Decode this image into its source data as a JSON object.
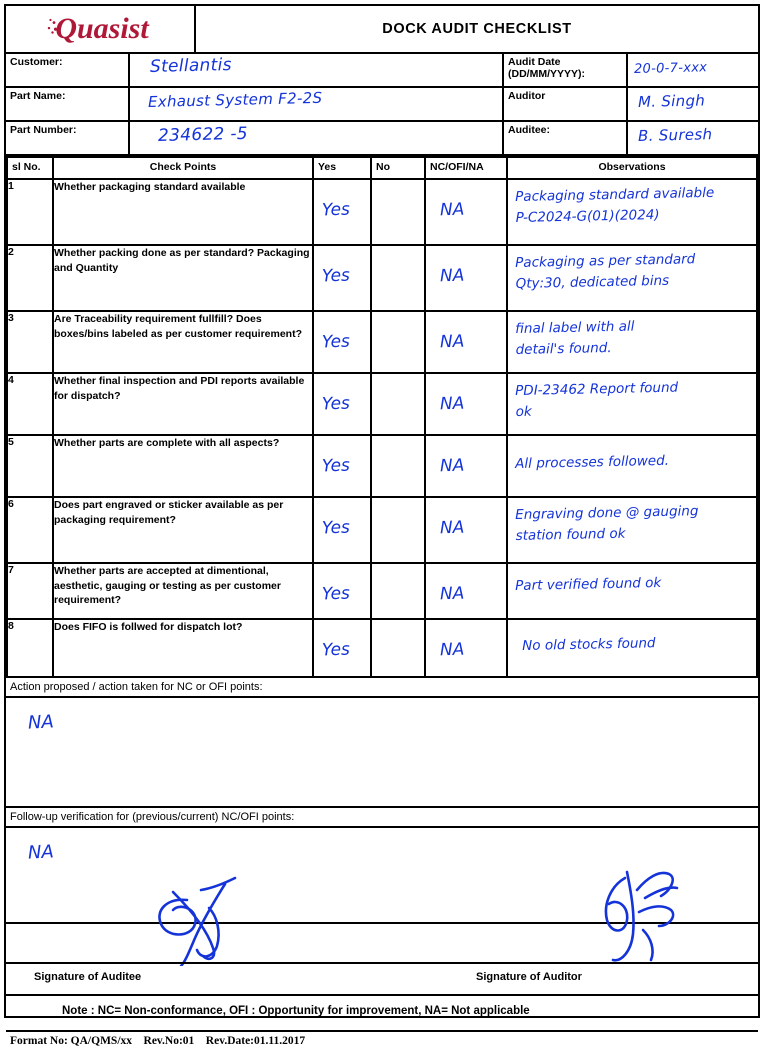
{
  "header": {
    "logo_text": "Quasist",
    "document_title": "DOCK AUDIT CHECKLIST"
  },
  "meta": {
    "customer_label": "Customer:",
    "customer_value": "Stellantis",
    "part_name_label": "Part Name:",
    "part_name_value": "Exhaust System F2-2S",
    "part_number_label": "Part Number:",
    "part_number_value": "234622 -5",
    "audit_date_label": "Audit Date (DD/MM/YYYY):",
    "audit_date_label_line1": "Audit Date",
    "audit_date_label_line2": "(DD/MM/YYYY):",
    "audit_date_value": "20-0-7-xxx",
    "auditor_label": "Auditor",
    "auditor_value": "M. Singh",
    "auditee_label": "Auditee:",
    "auditee_value": "B. Suresh"
  },
  "table": {
    "columns": [
      "sl No.",
      "Check Points",
      "Yes",
      "No",
      "NC/OFI/NA",
      "Observations"
    ],
    "rows": [
      {
        "sl": "1",
        "checkpoint": "Whether packaging standard available",
        "yes": "Yes",
        "no": "",
        "nc": "NA",
        "observation_line1": "Packaging standard available",
        "observation_line2": "P-C2024-G(01)(2024)"
      },
      {
        "sl": "2",
        "checkpoint": "Whether packing done as per standard? Packaging and Quantity",
        "yes": "Yes",
        "no": "",
        "nc": "NA",
        "observation_line1": "Packaging as per standard",
        "observation_line2": "Qty:30, dedicated bins"
      },
      {
        "sl": "3",
        "checkpoint": "Are Traceability requirement fullfill? Does boxes/bins labeled as per customer requirement?",
        "yes": "Yes",
        "no": "",
        "nc": "NA",
        "observation_line1": "final label with all",
        "observation_line2": "detail's found."
      },
      {
        "sl": "4",
        "checkpoint": "Whether final inspection and PDI reports available for dispatch?",
        "yes": "Yes",
        "no": "",
        "nc": "NA",
        "observation_line1": "PDI-23462 Report found",
        "observation_line2": "ok"
      },
      {
        "sl": "5",
        "checkpoint": "Whether parts are complete with all aspects?",
        "yes": "Yes",
        "no": "",
        "nc": "NA",
        "observation_line1": "All processes followed.",
        "observation_line2": ""
      },
      {
        "sl": "6",
        "checkpoint": "Does part engraved or sticker available as per packaging requirement?",
        "yes": "Yes",
        "no": "",
        "nc": "NA",
        "observation_line1": "Engraving done @ gauging",
        "observation_line2": "station found ok"
      },
      {
        "sl": "7",
        "checkpoint": "Whether parts are accepted at dimentional, aesthetic, gauging or testing as per customer requirement?",
        "yes": "Yes",
        "no": "",
        "nc": "NA",
        "observation_line1": "Part verified found ok",
        "observation_line2": ""
      },
      {
        "sl": "8",
        "checkpoint": "Does FIFO is follwed for dispatch lot?",
        "yes": "Yes",
        "no": "",
        "nc": "NA",
        "observation_line1": "No old stocks found",
        "observation_line2": ""
      }
    ]
  },
  "action_section": {
    "label": "Action proposed / action taken for NC or OFI points:",
    "value": "NA"
  },
  "followup_section": {
    "label": "Follow-up verification for (previous/current) NC/OFI points:",
    "value": "NA"
  },
  "signatures": {
    "auditee_label": "Signature of Auditee",
    "auditor_label": "Signature of Auditor"
  },
  "footer": {
    "note": "Note : NC= Non-conformance, OFI : Opportunity for improvement, NA= Not applicable",
    "format": "Format No: QA/QMS/xx    Rev.No:01    Rev.Date:01.11.2017"
  },
  "colors": {
    "logo": "#B01838",
    "ink": "#1433D8",
    "border": "#000000"
  }
}
